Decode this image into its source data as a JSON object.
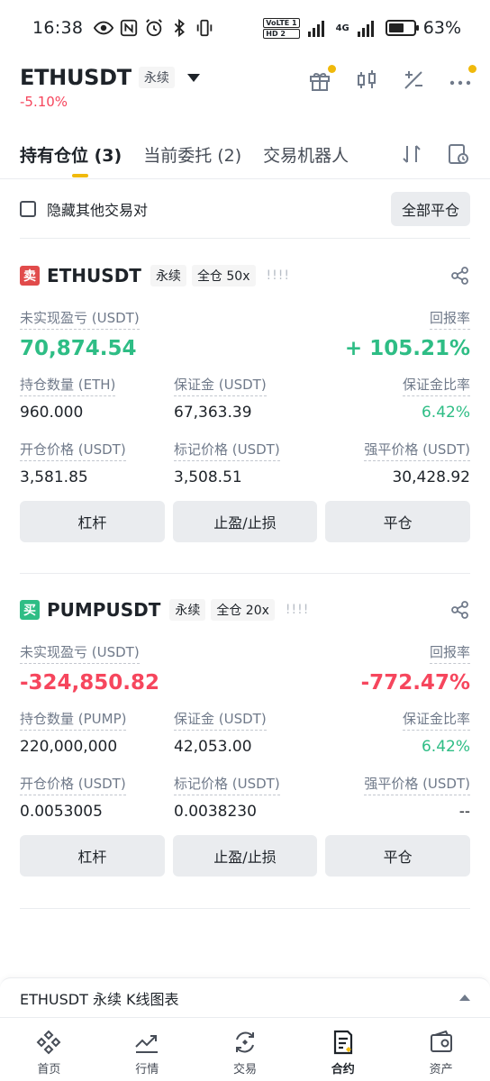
{
  "status": {
    "time": "16:38",
    "battery": "63%",
    "battery_level": 0.63,
    "volte_top": "VoLTE 1",
    "volte_bottom": "HD 2",
    "network": "4G"
  },
  "header": {
    "symbol": "ETHUSDT",
    "tag": "永续",
    "change": "-5.10%"
  },
  "tabs": [
    {
      "label": "持有仓位 (3)"
    },
    {
      "label": "当前委托 (2)"
    },
    {
      "label": "交易机器人"
    }
  ],
  "filter": {
    "hide_others": "隐藏其他交易对",
    "close_all": "全部平仓"
  },
  "positions": [
    {
      "side": "卖",
      "symbol": "ETHUSDT",
      "tag1": "永续",
      "tag2": "全仓 50x",
      "bars": "!!!!",
      "pnl_label": "未实现盈亏 (USDT)",
      "pnl": "70,874.54",
      "roe_label": "回报率",
      "roe": "+ 105.21%",
      "size_label": "持仓数量 (ETH)",
      "size": "960.000",
      "margin_label": "保证金 (USDT)",
      "margin": "67,363.39",
      "ratio_label": "保证金比率",
      "ratio": "6.42%",
      "entry_label": "开仓价格 (USDT)",
      "entry": "3,581.85",
      "mark_label": "标记价格 (USDT)",
      "mark": "3,508.51",
      "liq_label": "强平价格 (USDT)",
      "liq": "30,428.92",
      "btn_leverage": "杠杆",
      "btn_tpsl": "止盈/止损",
      "btn_close": "平仓"
    },
    {
      "side": "买",
      "symbol": "PUMPUSDT",
      "tag1": "永续",
      "tag2": "全仓 20x",
      "bars": "!!!!",
      "pnl_label": "未实现盈亏 (USDT)",
      "pnl": "-324,850.82",
      "roe_label": "回报率",
      "roe": "-772.47%",
      "size_label": "持仓数量 (PUMP)",
      "size": "220,000,000",
      "margin_label": "保证金 (USDT)",
      "margin": "42,053.00",
      "ratio_label": "保证金比率",
      "ratio": "6.42%",
      "entry_label": "开仓价格 (USDT)",
      "entry": "0.0053005",
      "mark_label": "标记价格 (USDT)",
      "mark": "0.0038230",
      "liq_label": "强平价格 (USDT)",
      "liq": "--",
      "btn_leverage": "杠杆",
      "btn_tpsl": "止盈/止损",
      "btn_close": "平仓"
    }
  ],
  "kline": {
    "label": "ETHUSDT 永续 K线图表"
  },
  "nav": [
    {
      "label": "首页",
      "icon": "home-icon"
    },
    {
      "label": "行情",
      "icon": "markets-icon"
    },
    {
      "label": "交易",
      "icon": "trade-icon"
    },
    {
      "label": "合约",
      "icon": "futures-icon"
    },
    {
      "label": "资产",
      "icon": "wallet-icon"
    }
  ],
  "colors": {
    "accent": "#f0b90b",
    "green": "#2ebd85",
    "red": "#f6465d"
  }
}
